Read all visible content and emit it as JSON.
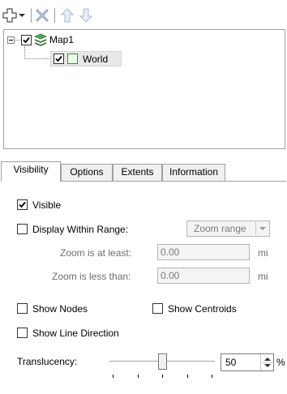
{
  "toolbar": {
    "icons": [
      "add-layer-icon",
      "dropdown-arrow-icon",
      "remove-icon",
      "move-up-icon",
      "move-down-icon"
    ]
  },
  "tree": {
    "map_label": "Map1",
    "layer_label": "World",
    "map_checked": true,
    "layer_checked": true
  },
  "tabs": [
    {
      "label": "Visibility",
      "active": true
    },
    {
      "label": "Options",
      "active": false
    },
    {
      "label": "Extents",
      "active": false
    },
    {
      "label": "Information",
      "active": false
    }
  ],
  "visibility": {
    "visible_label": "Visible",
    "visible_checked": true,
    "display_within_range_label": "Display Within Range:",
    "display_within_range_checked": false,
    "range_dropdown_value": "Zoom range",
    "zoom_at_least_label": "Zoom is at least:",
    "zoom_at_least_value": "0.00",
    "zoom_at_least_unit": "mi",
    "zoom_less_than_label": "Zoom is less than:",
    "zoom_less_than_value": "0.00",
    "zoom_less_than_unit": "mi",
    "show_nodes_label": "Show Nodes",
    "show_nodes_checked": false,
    "show_centroids_label": "Show Centroids",
    "show_centroids_checked": false,
    "show_line_direction_label": "Show Line Direction",
    "show_line_direction_checked": false,
    "translucency_label": "Translucency:",
    "translucency_value": "50",
    "translucency_unit": "%",
    "translucency_fraction": 0.5
  },
  "colors": {
    "layer_swatch_fill": "#e8ffe8",
    "layer_swatch_border": "#3a8a3a",
    "arrow_disabled": "#a8b8d8",
    "remove_disabled": "#8a9ab8"
  }
}
